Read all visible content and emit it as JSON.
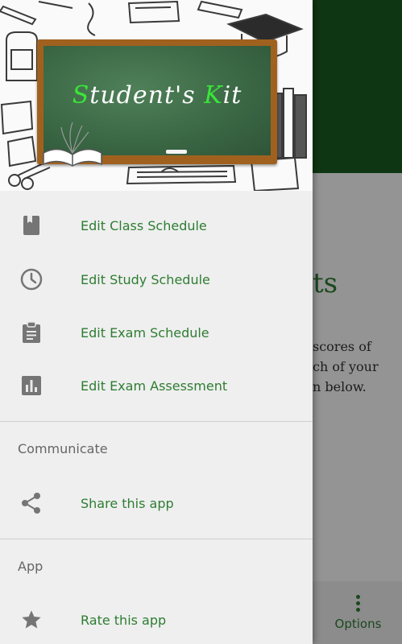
{
  "background": {
    "heading_fragment": "ts",
    "desc_lines": [
      "scores of",
      "ch of your",
      "n below."
    ],
    "options_label": "Options"
  },
  "drawer": {
    "header": {
      "title_s": "S",
      "title_mid": "tudent's ",
      "title_k": "K",
      "title_end": "it"
    },
    "items": [
      {
        "label": "Edit Class Schedule",
        "icon": "book-icon"
      },
      {
        "label": "Edit Study Schedule",
        "icon": "clock-icon"
      },
      {
        "label": "Edit Exam Schedule",
        "icon": "clipboard-icon"
      },
      {
        "label": "Edit Exam Assessment",
        "icon": "bar-chart-icon"
      }
    ],
    "communicate": {
      "title": "Communicate",
      "items": [
        {
          "label": "Share this app",
          "icon": "share-icon"
        }
      ]
    },
    "app": {
      "title": "App",
      "items": [
        {
          "label": "Rate this app",
          "icon": "star-icon"
        }
      ]
    }
  },
  "colors": {
    "primary": "#1b5e20",
    "accent_text": "#2e7d32",
    "icon_gray": "#757575",
    "chalk_green": "#39e639"
  }
}
